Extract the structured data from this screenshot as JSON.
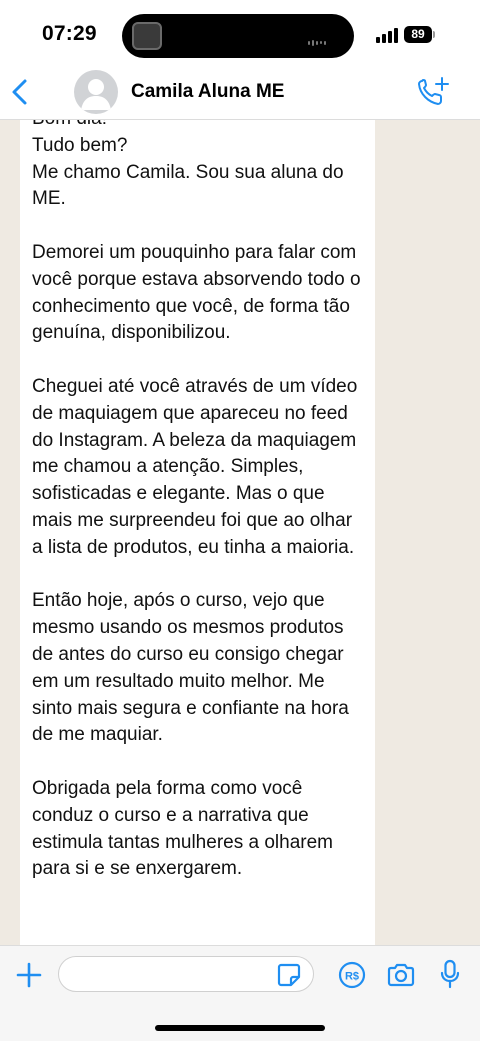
{
  "status_bar": {
    "time": "07:29",
    "battery": "89",
    "island_icons": [
      "media-thumbnail-icon",
      "audio-waveform-icon"
    ]
  },
  "header": {
    "contact_name": "Camila Aluna ME",
    "icons": [
      "back-chevron-icon",
      "avatar-placeholder-icon",
      "add-call-icon"
    ]
  },
  "chat": {
    "message_text": "Bom dia!\nTudo bem?\nMe chamo Camila. Sou sua aluna do ME.\n\nDemorei um pouquinho para falar com você porque estava absorvendo todo o conhecimento que você, de forma tão genuína, disponibilizou.\n\nCheguei até você através de um vídeo de maquiagem que apareceu no feed do Instagram. A beleza da maquiagem me chamou a atenção. Simples, sofisticadas e elegante. Mas o que mais me surpreendeu foi que ao olhar a lista de produtos, eu tinha a maioria.\n\nEntão hoje, após o curso, vejo que mesmo usando os mesmos produtos de antes do curso eu consigo chegar em um resultado muito melhor. Me sinto mais segura e confiante na hora de me maquiar.\n\nObrigada pela forma como você conduz o curso e a narrativa que estimula tantas mulheres a olharem para si e se enxergarem."
  },
  "composer": {
    "input_value": "",
    "icons": [
      "plus-icon",
      "sticker-icon",
      "payment-icon",
      "camera-icon",
      "microphone-icon"
    ]
  },
  "colors": {
    "accent": "#1f8ef1",
    "chat_background": "#efeae2",
    "bubble": "#ffffff"
  }
}
